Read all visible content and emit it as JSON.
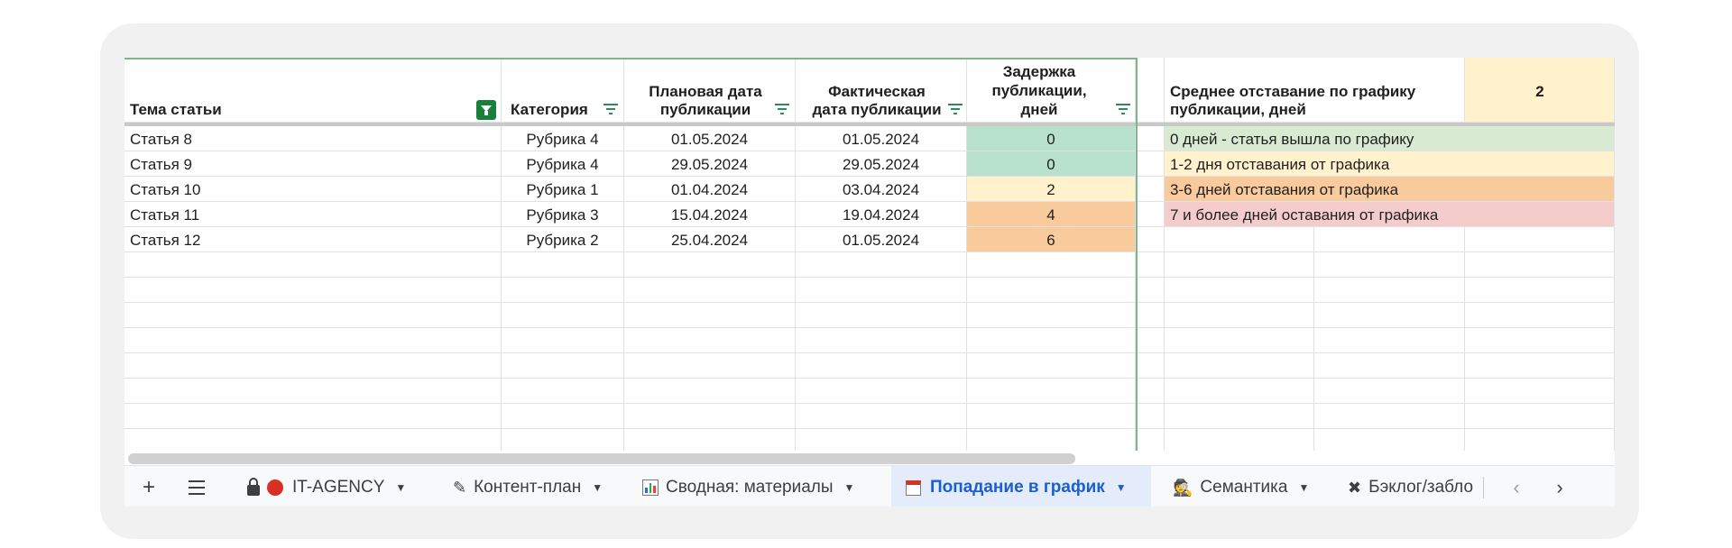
{
  "headers": {
    "topic": "Тема статьи",
    "category": "Категория",
    "planned_line1": "Плановая дата",
    "planned_line2": "публикации",
    "actual_line1": "Фактическая",
    "actual_line2": "дата публикации",
    "delay_line1": "Задержка",
    "delay_line2": "публикации,",
    "delay_line3": "дней",
    "avg_line1": "Среднее отставание по графику",
    "avg_line2": "публикации, дней",
    "avg_value": "2"
  },
  "rows": [
    {
      "topic": "Статья 8",
      "category": "Рубрика 4",
      "planned": "01.05.2024",
      "actual": "01.05.2024",
      "delay": "0"
    },
    {
      "topic": "Статья 9",
      "category": "Рубрика 4",
      "planned": "29.05.2024",
      "actual": "29.05.2024",
      "delay": "0"
    },
    {
      "topic": "Статья 10",
      "category": "Рубрика 1",
      "planned": "01.04.2024",
      "actual": "03.04.2024",
      "delay": "2"
    },
    {
      "topic": "Статья 11",
      "category": "Рубрика 3",
      "planned": "15.04.2024",
      "actual": "19.04.2024",
      "delay": "4"
    },
    {
      "topic": "Статья 12",
      "category": "Рубрика 2",
      "planned": "25.04.2024",
      "actual": "01.05.2024",
      "delay": "6"
    }
  ],
  "legend": [
    {
      "text": "0 дней - статья вышла по графику",
      "color": "#d9ead3"
    },
    {
      "text": "1-2 дня отставания от графика",
      "color": "#fff2cc"
    },
    {
      "text": "3-6 дней отставания от графика",
      "color": "#f9cb9c"
    },
    {
      "text": "7 и более дней оставания от графика",
      "color": "#f4cccc"
    }
  ],
  "colors": {
    "delay_zero": "#b7e1cd",
    "delay_low": "#fff2cc",
    "delay_mid": "#f9cb9c",
    "avg_bg": "#fff2cc",
    "frozen_line": "#7fb58a",
    "active_tab": "#1a5fd0"
  },
  "tabs": [
    {
      "label": "IT-AGENCY",
      "icons": [
        "lock-icon",
        "red-circle-icon"
      ]
    },
    {
      "label": "Контент-план",
      "icons": [
        "pencil-icon"
      ]
    },
    {
      "label": "Сводная: материалы",
      "icons": [
        "chart-icon"
      ]
    },
    {
      "label": "Попадание в график",
      "icons": [
        "calendar-icon"
      ],
      "active": true
    },
    {
      "label": "Семантика",
      "icons": [
        "detective-icon"
      ]
    },
    {
      "label": "Бэклог/забло",
      "icons": [
        "tools-icon"
      ]
    }
  ]
}
